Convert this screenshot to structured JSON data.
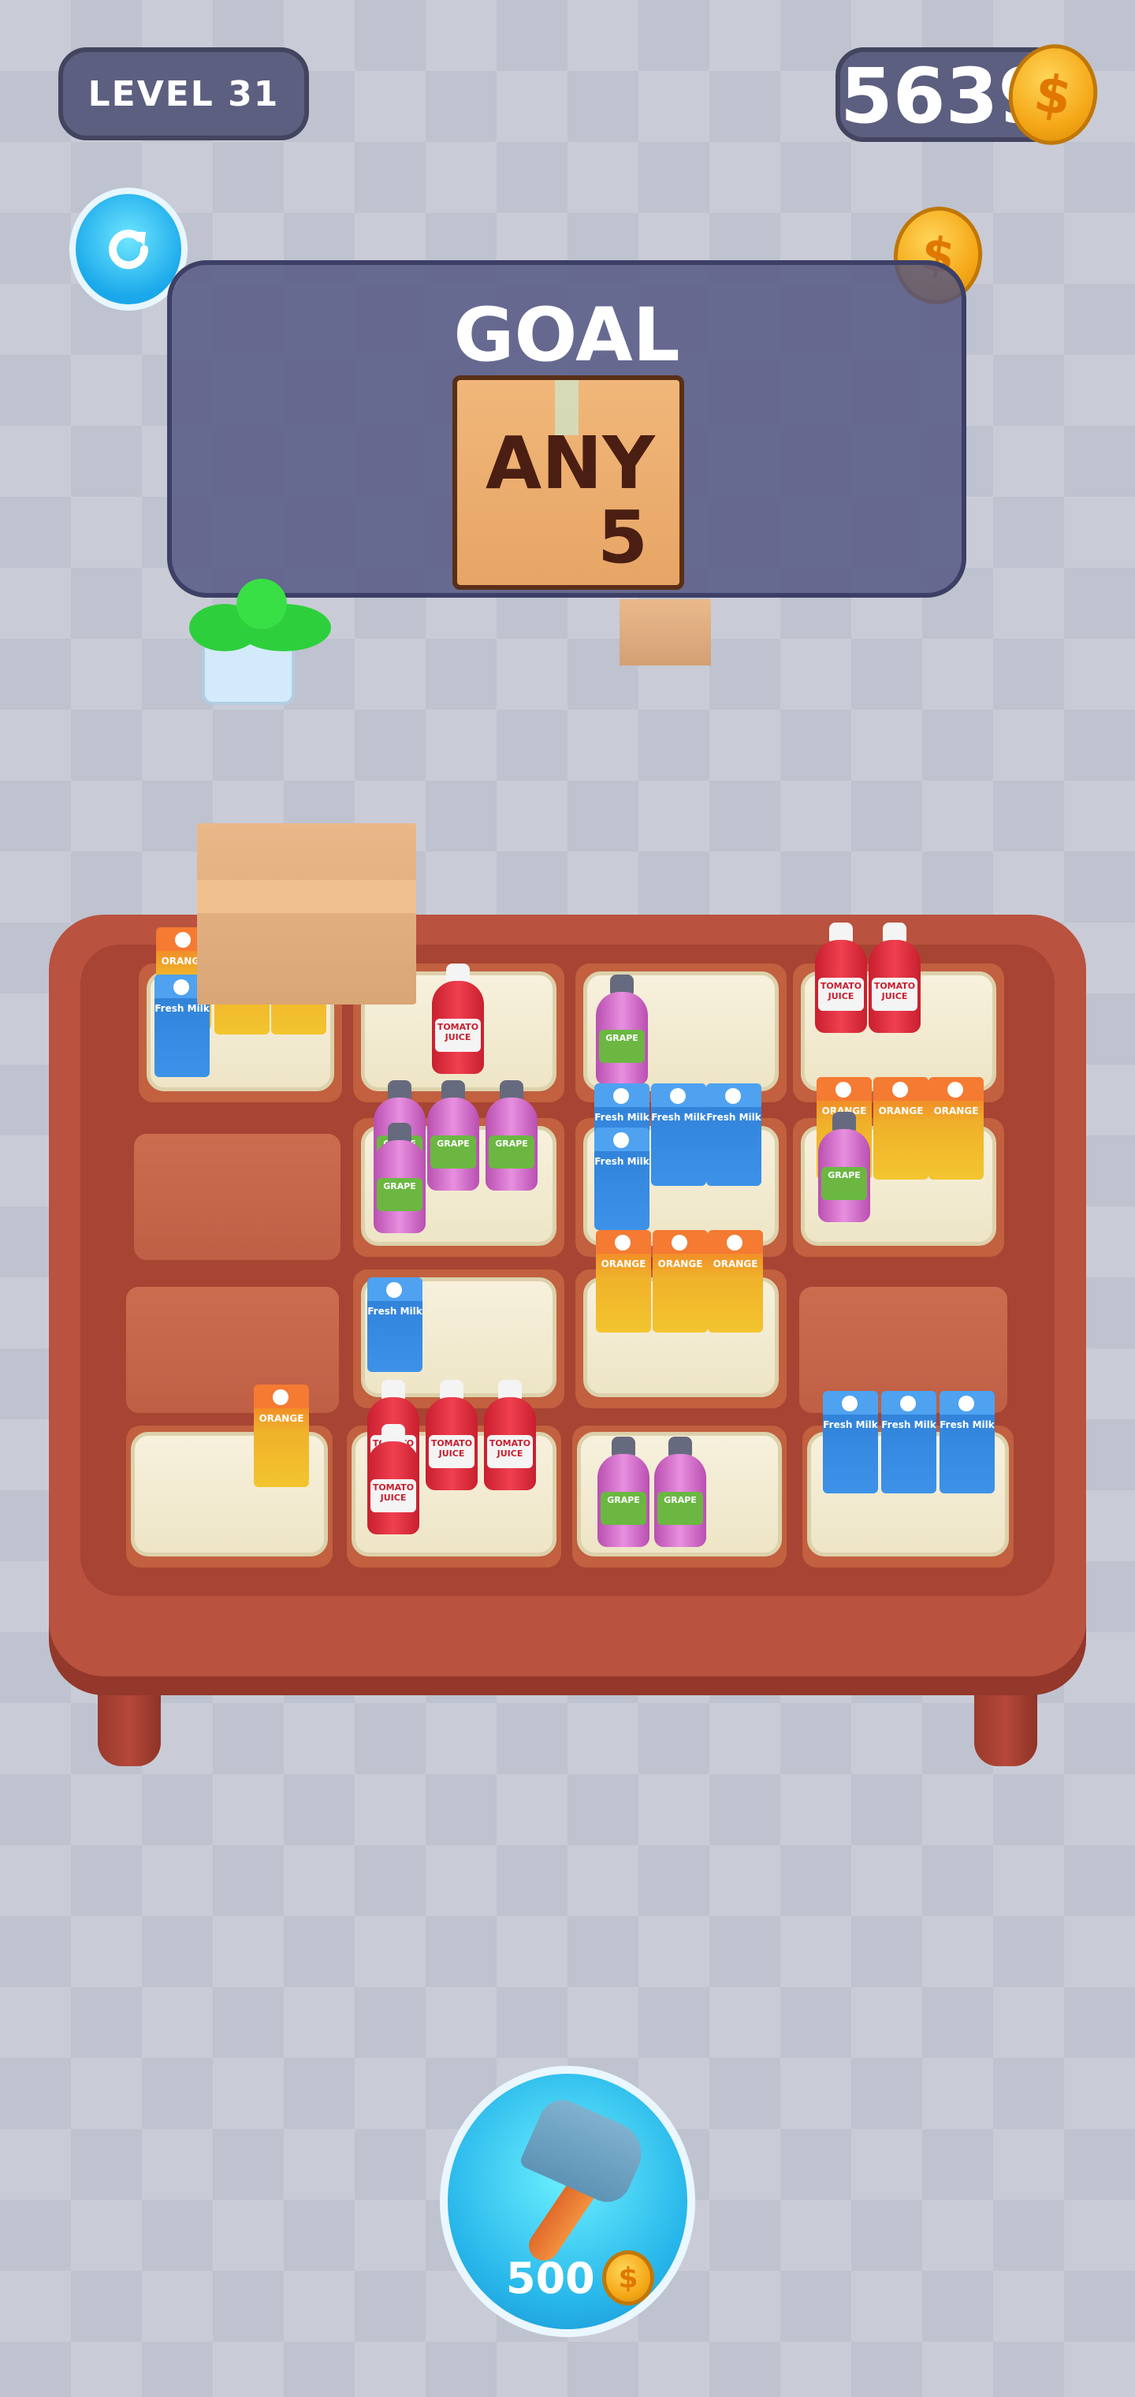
{
  "hud": {
    "level_label": "LEVEL 31",
    "coins": "5639",
    "coin_symbol": "$"
  },
  "goal": {
    "title": "GOAL",
    "box_text": "ANY",
    "box_count": "5"
  },
  "booster": {
    "price": "500",
    "coin_symbol": "$"
  },
  "icons": {
    "restart": "restart-icon",
    "hammer": "hammer-icon",
    "coin": "coin-icon"
  },
  "items": {
    "tomato_label": "TOMATO JUICE",
    "grape_label": "GRAPE",
    "milk_label": "Fresh Milk",
    "orange_label": "ORANGE"
  },
  "colors": {
    "accent": "#27b6ea",
    "panel": "#5d5f80",
    "table": "#b9523f"
  }
}
